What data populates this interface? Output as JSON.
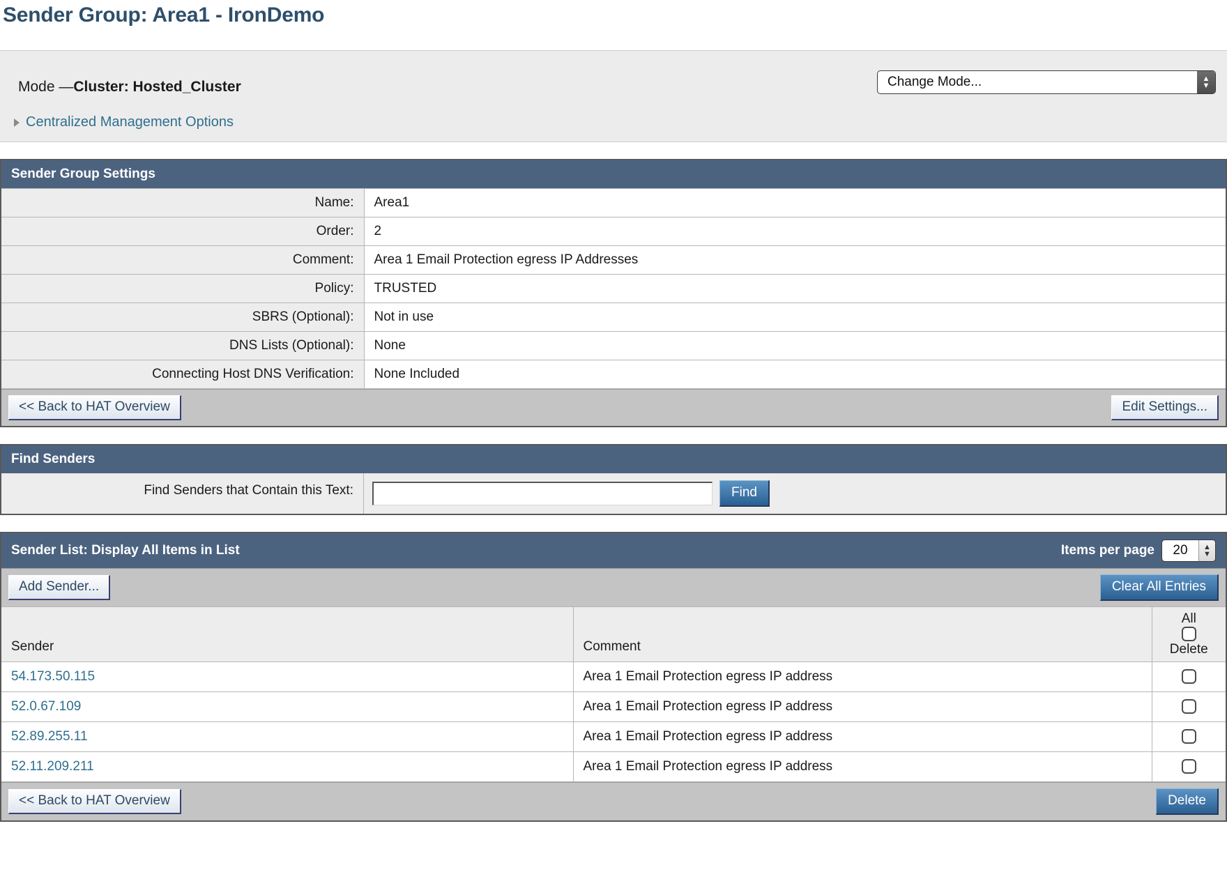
{
  "page": {
    "title": "Sender Group: Area1 - IronDemo"
  },
  "mode_bar": {
    "mode_prefix": "Mode —",
    "mode_value": "Cluster: Hosted_Cluster",
    "centralized_link": "Centralized Management Options",
    "change_mode_select": "Change Mode..."
  },
  "sender_group_settings": {
    "heading": "Sender Group Settings",
    "rows": [
      {
        "label": "Name:",
        "value": "Area1"
      },
      {
        "label": "Order:",
        "value": "2"
      },
      {
        "label": "Comment:",
        "value": "Area 1 Email Protection egress IP Addresses"
      },
      {
        "label": "Policy:",
        "value": "TRUSTED"
      },
      {
        "label": "SBRS (Optional):",
        "value": "Not in use"
      },
      {
        "label": "DNS Lists (Optional):",
        "value": "None"
      },
      {
        "label": "Connecting Host DNS Verification:",
        "value": "None Included"
      }
    ],
    "back_button": "<< Back to HAT Overview",
    "edit_button": "Edit Settings..."
  },
  "find_senders": {
    "heading": "Find Senders",
    "label": "Find Senders that Contain this Text:",
    "input_value": "",
    "input_placeholder": "",
    "find_button": "Find"
  },
  "sender_list": {
    "heading": "Sender List: Display All Items in List",
    "items_per_page_label": "Items per page",
    "items_per_page_value": "20",
    "add_sender_button": "Add Sender...",
    "clear_all_button": "Clear All Entries",
    "columns": {
      "sender": "Sender",
      "comment": "Comment",
      "delete_all": "All",
      "delete": "Delete"
    },
    "rows": [
      {
        "sender": "54.173.50.115",
        "comment": "Area 1 Email Protection egress IP address"
      },
      {
        "sender": "52.0.67.109",
        "comment": "Area 1 Email Protection egress IP address"
      },
      {
        "sender": "52.89.255.11",
        "comment": "Area 1 Email Protection egress IP address"
      },
      {
        "sender": "52.11.209.211",
        "comment": "Area 1 Email Protection egress IP address"
      }
    ],
    "back_button": "<< Back to HAT Overview",
    "delete_button": "Delete"
  },
  "colors": {
    "panel_header": "#4c6380",
    "title": "#2d4f6b",
    "link": "#2e6f8e",
    "primary_button": "#2b5f92"
  }
}
